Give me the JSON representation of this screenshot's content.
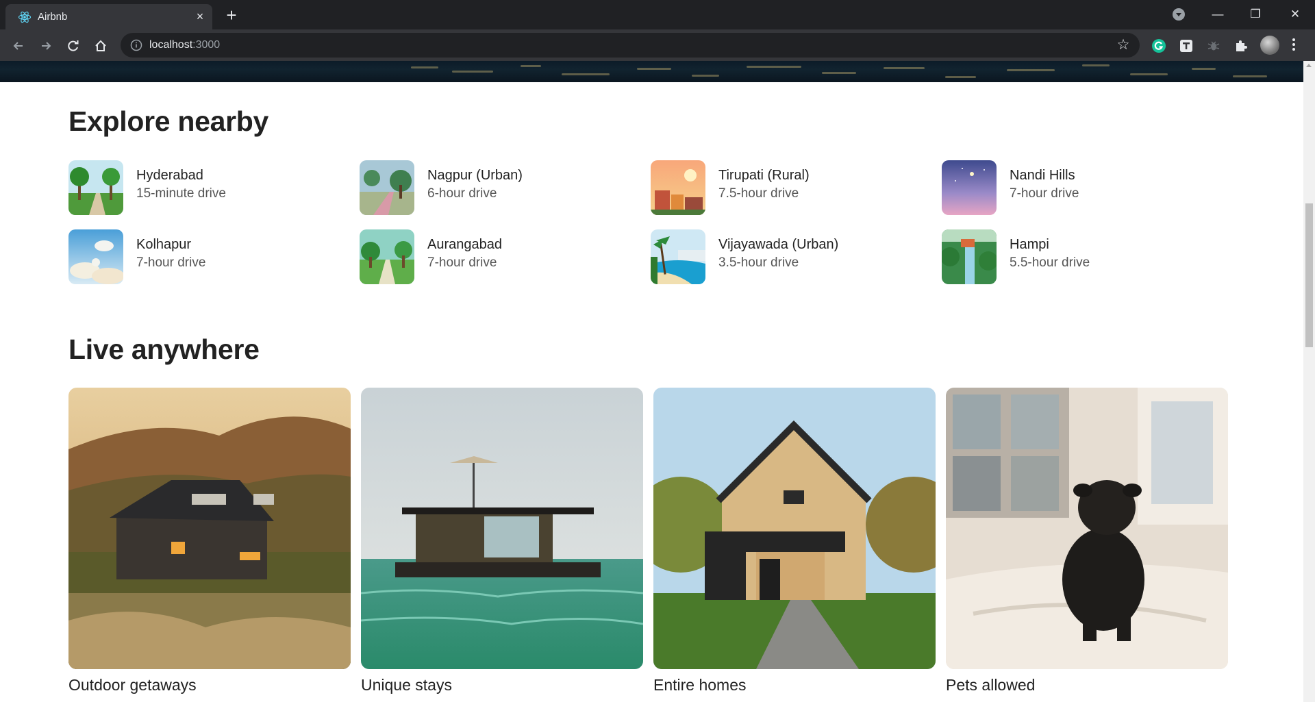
{
  "browser": {
    "tab_title": "Airbnb",
    "tab_close": "×",
    "new_tab": "+",
    "url_host": "localhost",
    "url_port": ":3000",
    "window_controls": [
      "—",
      "❐",
      "✕"
    ]
  },
  "explore": {
    "title": "Explore nearby",
    "items": [
      {
        "name": "Hyderabad",
        "time": "15-minute drive"
      },
      {
        "name": "Nagpur (Urban)",
        "time": "6-hour drive"
      },
      {
        "name": "Tirupati (Rural)",
        "time": "7.5-hour drive"
      },
      {
        "name": "Nandi Hills",
        "time": "7-hour drive"
      },
      {
        "name": "Kolhapur",
        "time": "7-hour drive"
      },
      {
        "name": "Aurangabad",
        "time": "7-hour drive"
      },
      {
        "name": "Vijayawada (Urban)",
        "time": "3.5-hour drive"
      },
      {
        "name": "Hampi",
        "time": "5.5-hour drive"
      }
    ]
  },
  "live": {
    "title": "Live anywhere",
    "cards": [
      {
        "label": "Outdoor getaways"
      },
      {
        "label": "Unique stays"
      },
      {
        "label": "Entire homes"
      },
      {
        "label": "Pets allowed"
      }
    ]
  },
  "colors": {
    "text": "#222222",
    "subtext": "#555555",
    "chrome_dark": "#202124",
    "chrome_mid": "#35363a"
  }
}
